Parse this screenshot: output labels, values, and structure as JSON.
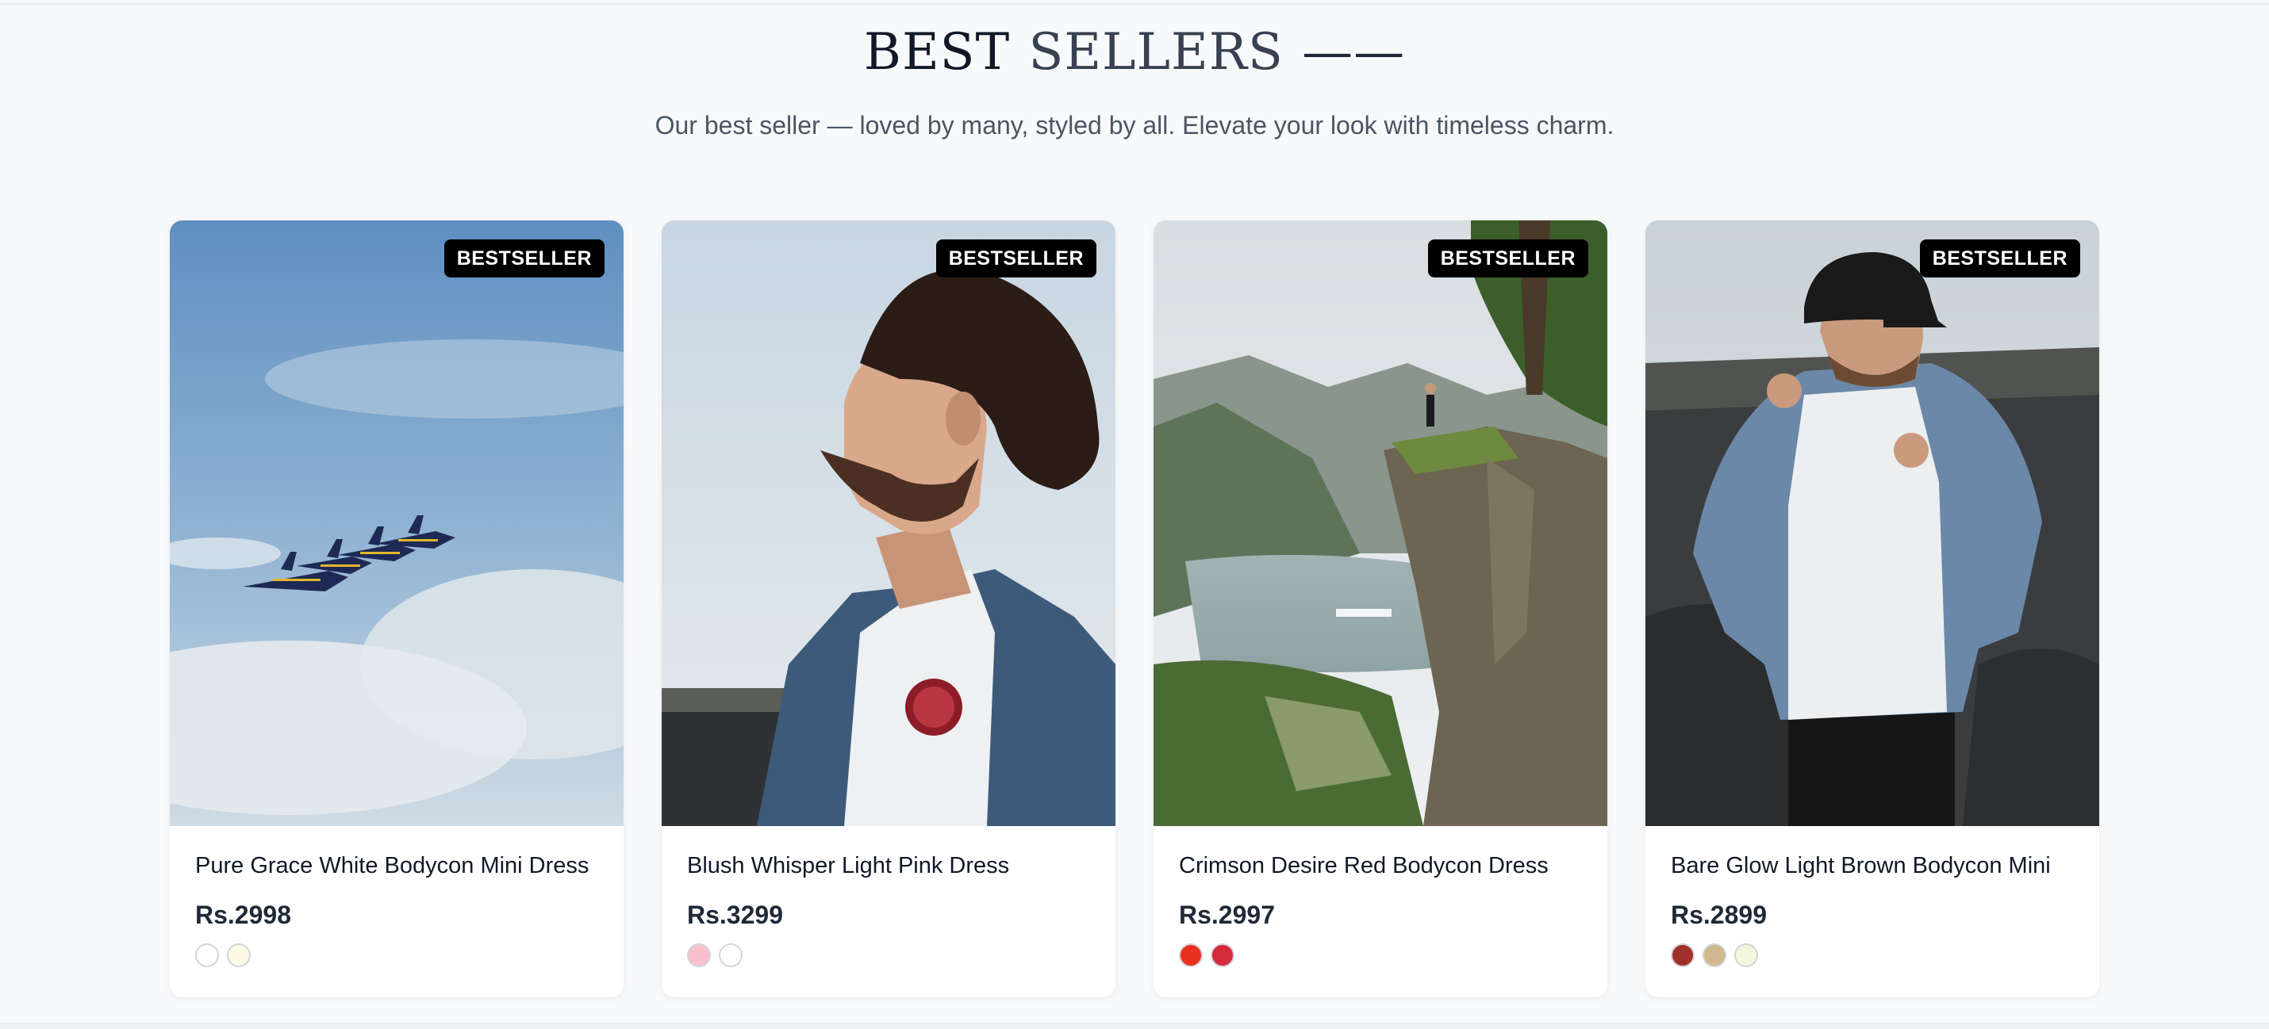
{
  "section": {
    "title_part1": "BEST",
    "title_part2": "SELLERS",
    "title_dash": "——",
    "subtitle": "Our best seller — loved by many, styled by all. Elevate your look with timeless charm."
  },
  "products": [
    {
      "badge": "BESTSELLER",
      "name": "Pure Grace White Bodycon Mini Dress",
      "price": "Rs.2998",
      "image": "jets-in-sky",
      "colors": [
        "#ffffff",
        "#fdfbe6"
      ]
    },
    {
      "badge": "BESTSELLER",
      "name": "Blush Whisper Light Pink Dress",
      "price": "Rs.3299",
      "image": "man-profile-denim-jacket",
      "colors": [
        "#f9c0cb",
        "#ffffff"
      ]
    },
    {
      "badge": "BESTSELLER",
      "name": "Crimson Desire Red Bodycon Dress",
      "price": "Rs.2997",
      "image": "cliff-over-fjord",
      "colors": [
        "#e8321f",
        "#d42a3a"
      ]
    },
    {
      "badge": "BESTSELLER",
      "name": "Bare Glow Light Brown Bodycon Mini",
      "price": "Rs.2899",
      "image": "man-cap-denim-jacket",
      "colors": [
        "#a0302c",
        "#d2b88e",
        "#f4f6dc"
      ]
    }
  ]
}
